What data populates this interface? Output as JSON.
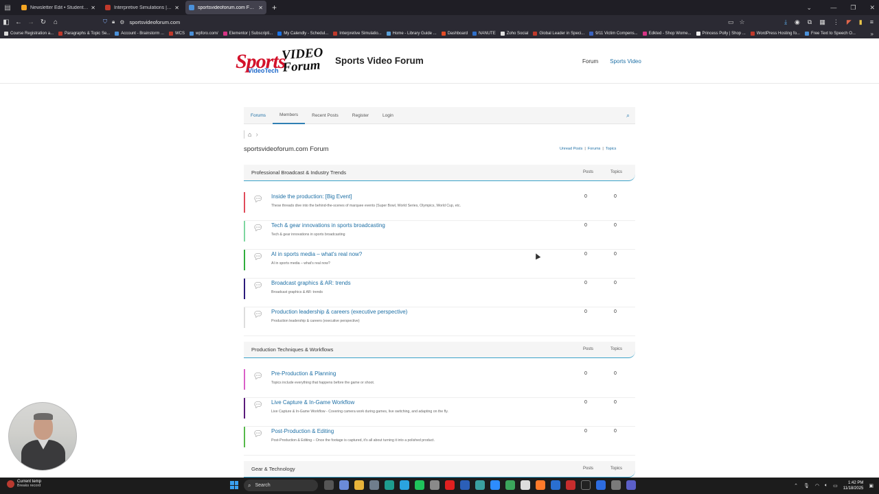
{
  "browser": {
    "tabs": [
      {
        "label": "Newsletter Edit • Student Filmm",
        "color": "#f5a623",
        "active": false
      },
      {
        "label": "Interpretive Simulations | Pharm",
        "color": "#c0392b",
        "active": false
      },
      {
        "label": "sportsvideoforum.com Forum -",
        "color": "#4a90d9",
        "active": true
      }
    ],
    "url": "sportsvideoforum.com",
    "bookmarks": [
      {
        "label": "Course Registration a...",
        "color": "#d9d9d9"
      },
      {
        "label": "Paragraphs & Topic Se...",
        "color": "#c0392b"
      },
      {
        "label": "Account - Brainstorm ...",
        "color": "#4a90d9"
      },
      {
        "label": "WCS",
        "color": "#c0392b"
      },
      {
        "label": "wpforo.com/",
        "color": "#4a90d9"
      },
      {
        "label": "Elementor | Subscripti...",
        "color": "#d63384"
      },
      {
        "label": "My Calendly - Schedul...",
        "color": "#1a73e8"
      },
      {
        "label": "Interpretive Simulatio...",
        "color": "#c0392b"
      },
      {
        "label": "Home - Library Guide ...",
        "color": "#5aa0d8"
      },
      {
        "label": "Dashboard",
        "color": "#e34c26"
      },
      {
        "label": "NANUTE",
        "color": "#2f6fc9"
      },
      {
        "label": "Zoho Social",
        "color": "#e0e0e0"
      },
      {
        "label": "Global Leader in Speci...",
        "color": "#c0392b"
      },
      {
        "label": "9/11 Victim Compens...",
        "color": "#3a63c0"
      },
      {
        "label": "Edkted - Shop Wome...",
        "color": "#d63384"
      },
      {
        "label": "Princess Polly | Shop ...",
        "color": "#eeeeee"
      },
      {
        "label": "WordPress Hosting fo...",
        "color": "#c0392b"
      },
      {
        "label": "Free Text to Speech O...",
        "color": "#4a90d9"
      }
    ]
  },
  "site": {
    "logo_main": "Sports",
    "logo_sub": "VideoTech",
    "logo_video": "VIDEO",
    "logo_forum": "Forum",
    "title": "Sports Video Forum",
    "nav": [
      "Forum",
      "Sports Video"
    ]
  },
  "forum_nav": {
    "items": [
      "Forums",
      "Members",
      "Recent Posts",
      "Register",
      "Login"
    ]
  },
  "forum": {
    "title": "sportsvideoforum.com Forum",
    "links": {
      "unread": "Unread Posts",
      "sep": "|",
      "forums": "Forums",
      "topics": "Topics"
    },
    "col_posts": "Posts",
    "col_topics": "Topics"
  },
  "categories": [
    {
      "name": "Professional Broadcast & Industry Trends",
      "forums": [
        {
          "title": "Inside the production: [Big Event]",
          "desc": "These threads dive into the behind-the-scenes of marquee events (Super Bowl, World Series, Olympics, World Cup, etc.",
          "posts": "0",
          "topics": "0",
          "color": "#e04b5a"
        },
        {
          "title": "Tech & gear innovations in sports broadcasting",
          "desc": "Tech & gear innovations in sports broadcasting",
          "posts": "0",
          "topics": "0",
          "color": "#7ed6a0"
        },
        {
          "title": "AI in sports media – what's real now?",
          "desc": "AI in sports media – what's real now?",
          "posts": "0",
          "topics": "0",
          "color": "#2fae3c"
        },
        {
          "title": "Broadcast graphics & AR: trends",
          "desc": "Broadcast graphics & AR: trends",
          "posts": "0",
          "topics": "0",
          "color": "#2a1a7a"
        },
        {
          "title": "Production leadership & careers (executive perspective)",
          "desc": "Production leadership & careers (executive perspective)",
          "posts": "0",
          "topics": "0",
          "color": "#dddddd"
        }
      ]
    },
    {
      "name": "Production Techniques & Workflows",
      "forums": [
        {
          "title": "Pre-Production & Planning",
          "desc": "Topics include everything that happens before the game or shoot.",
          "posts": "0",
          "topics": "0",
          "color": "#d95fc7"
        },
        {
          "title": "Live Capture & In-Game Workflow",
          "desc": "Live Capture & In-Game Workflow - Covering camera work during games, live switching, and adapting on the fly.",
          "posts": "0",
          "topics": "0",
          "color": "#5a1a7a"
        },
        {
          "title": "Post-Production & Editing",
          "desc": "Post-Production & Editing – Once the footage is captured, it's all about turning it into a polished product.",
          "posts": "0",
          "topics": "0",
          "color": "#56b94a"
        }
      ]
    },
    {
      "name": "Gear & Technology",
      "forums": []
    }
  ],
  "taskbar": {
    "weather_title": "Current temp",
    "weather_sub": "Breaks record",
    "search": "Search",
    "time": "1:42 PM",
    "date": "11/18/2025"
  }
}
